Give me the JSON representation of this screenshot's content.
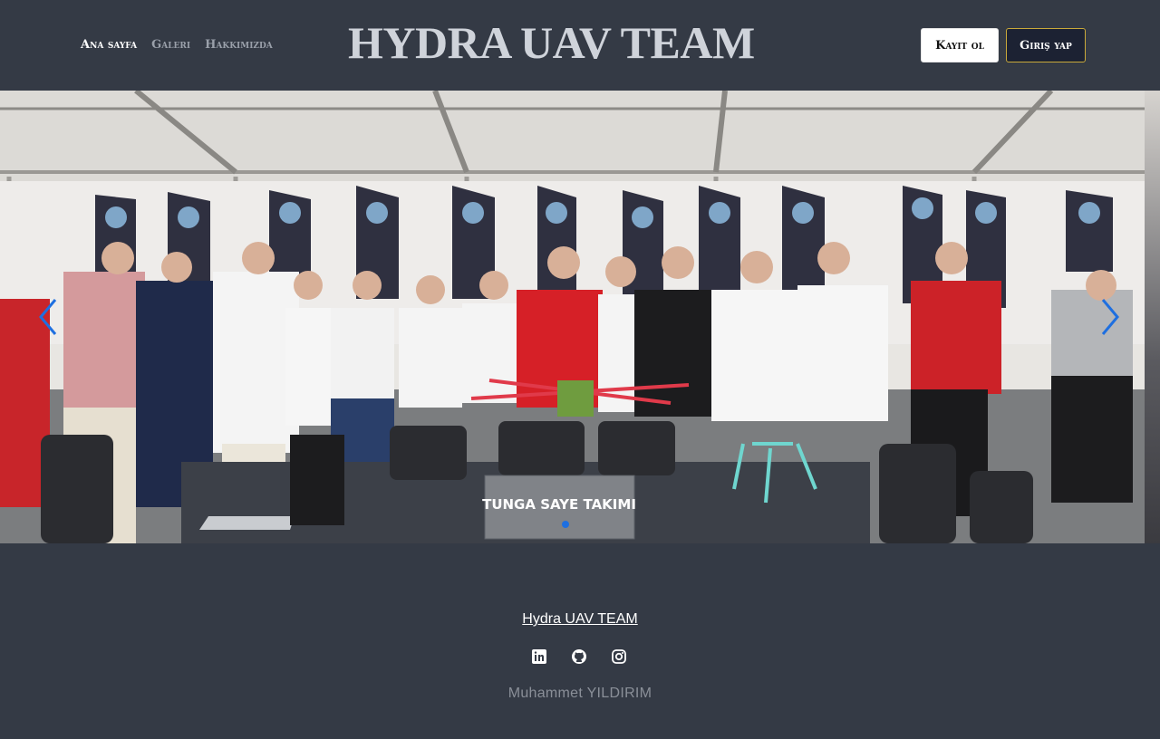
{
  "header": {
    "nav": [
      {
        "label": "Ana sayfa",
        "active": true
      },
      {
        "label": "Galeri",
        "active": false
      },
      {
        "label": "Hakkımızda",
        "active": false
      }
    ],
    "brand": "HYDRA UAV TEAM",
    "register_label": "Kayıt ol",
    "login_label": "Giriş yap"
  },
  "carousel": {
    "slide_caption": "TUNGA SAYE TAKIMI",
    "prev_icon": "chevron-left-icon",
    "next_icon": "chevron-right-icon",
    "accent": "#1e6fe0"
  },
  "footer": {
    "team_link": "Hydra UAV TEAM",
    "social_icons": [
      "linkedin-icon",
      "github-icon",
      "instagram-icon"
    ],
    "credit": "Muhammet YILDIRIM"
  }
}
